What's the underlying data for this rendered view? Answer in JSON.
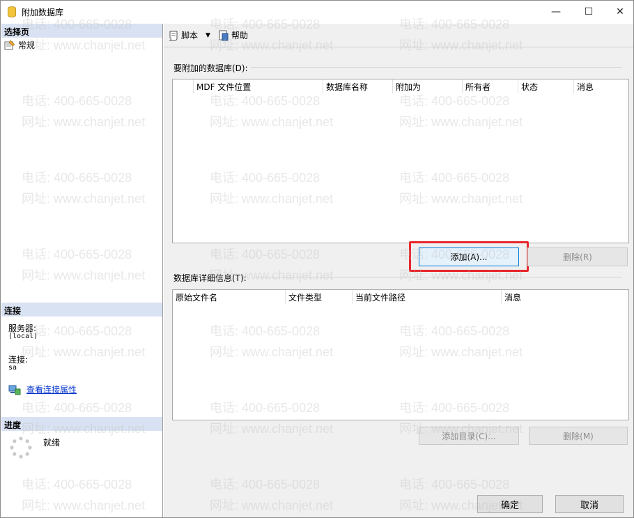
{
  "window": {
    "title": "附加数据库",
    "minimize": "—",
    "maximize": "☐",
    "close": "✕"
  },
  "left": {
    "select_page_header": "选择页",
    "pages": [
      {
        "label": "常规",
        "icon": "general-page-icon"
      }
    ],
    "connection_header": "连接",
    "server_label": "服务器:",
    "server_value": "(local)",
    "connection_label": "连接:",
    "connection_value": "sa",
    "view_props_link": "查看连接属性",
    "progress_header": "进度",
    "progress_status": "就绪"
  },
  "toolbar": {
    "script_label": "脚本",
    "help_label": "帮助"
  },
  "attach": {
    "group_label": "要附加的数据库(D):",
    "columns": [
      "MDF 文件位置",
      "数据库名称",
      "附加为",
      "所有者",
      "状态",
      "消息"
    ],
    "add_button": "添加(A)...",
    "remove_button": "删除(R)"
  },
  "details": {
    "group_label": "数据库详细信息(T):",
    "columns": [
      "原始文件名",
      "文件类型",
      "当前文件路径",
      "消息"
    ],
    "add_catalog_button": "添加目录(C)...",
    "remove_button": "删除(M)"
  },
  "dialog": {
    "ok": "确定",
    "cancel": "取消"
  },
  "watermark": {
    "phone": "电话: 400-665-0028",
    "site": "网址: www.chanjet.net"
  },
  "colors": {
    "section_header_bg": "#d9e2f2",
    "highlight": "#e8262b",
    "link": "#0033cc",
    "primary_border": "#0078d7"
  }
}
